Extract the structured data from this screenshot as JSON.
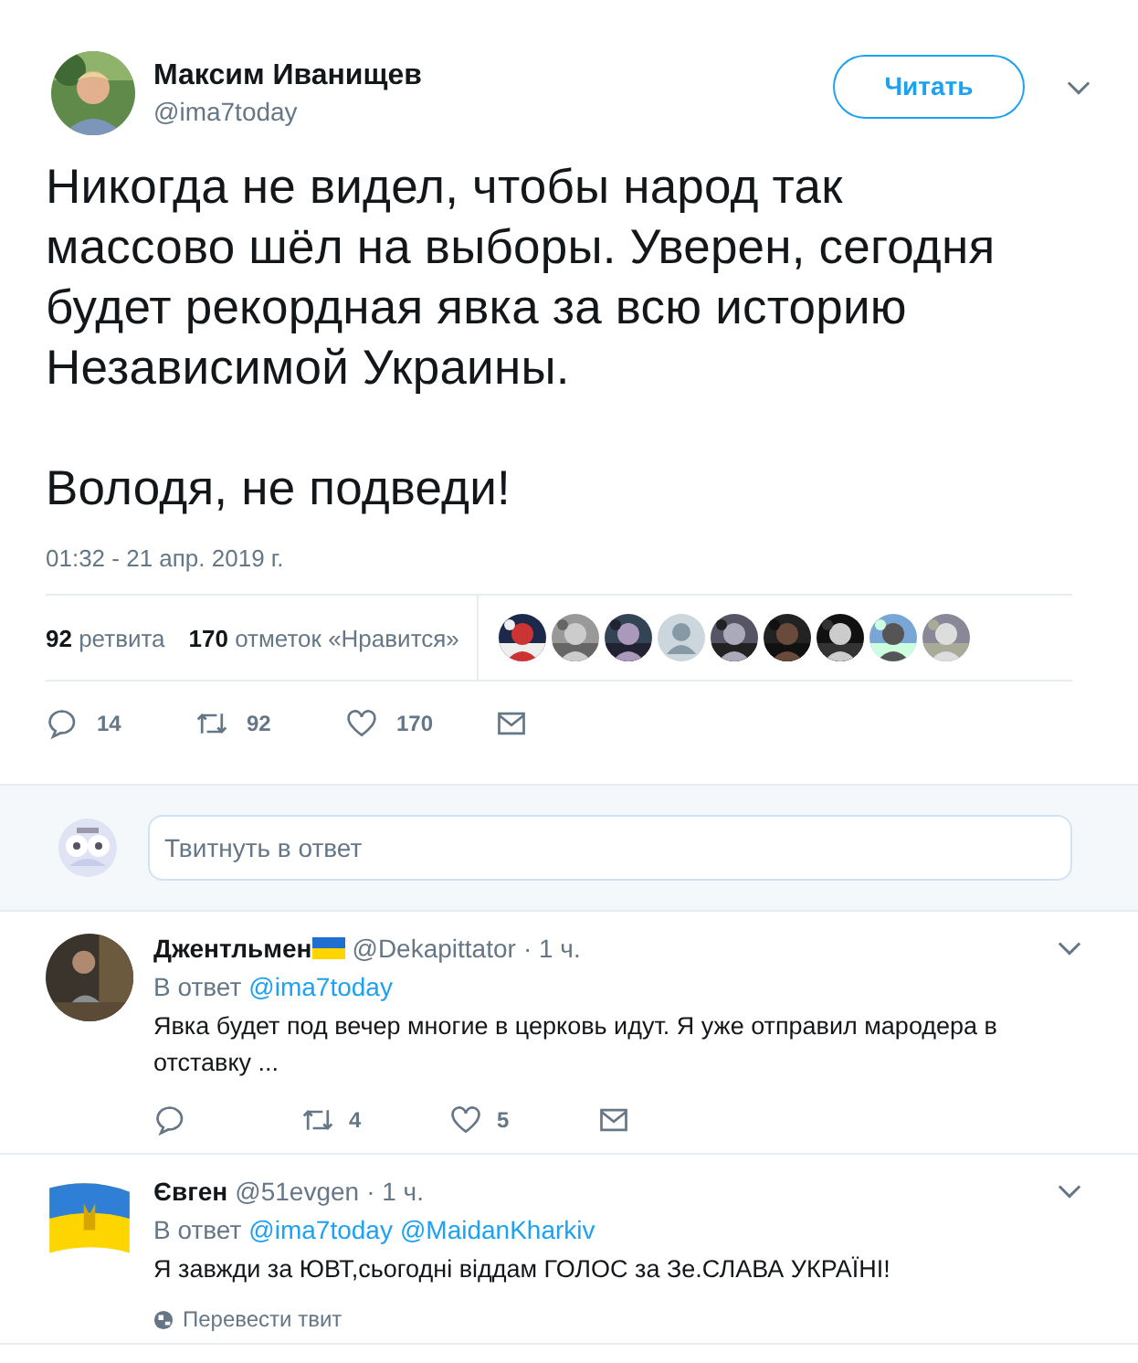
{
  "tweet": {
    "author": {
      "name": "Максим Иванищев",
      "handle": "@ima7today"
    },
    "follow_button": "Читать",
    "paragraphs": [
      "Никогда не видел, чтобы народ так массово шёл на выборы. Уверен, сегодня будет рекордная явка за всю историю Независимой Украины.",
      "Володя, не подведи!"
    ],
    "timestamp": "01:32 - 21 апр. 2019 г.",
    "stats": [
      {
        "count": "92",
        "label": "ретвита"
      },
      {
        "count": "170",
        "label": "отметок «Нравится»"
      }
    ],
    "likers": [
      {
        "kind": "picture"
      },
      {
        "kind": "picture"
      },
      {
        "kind": "picture"
      },
      {
        "kind": "default"
      },
      {
        "kind": "picture"
      },
      {
        "kind": "picture"
      },
      {
        "kind": "picture"
      },
      {
        "kind": "picture"
      },
      {
        "kind": "picture"
      }
    ],
    "actions": [
      {
        "kind": "reply",
        "count": "14"
      },
      {
        "kind": "retweet",
        "count": "92"
      },
      {
        "kind": "like",
        "count": "170"
      },
      {
        "kind": "message"
      }
    ]
  },
  "reply_box": {
    "placeholder": "Твитнуть в ответ"
  },
  "replies": [
    {
      "name": "Джентльмен",
      "flag": true,
      "handle": "@Dekapittator",
      "time": "· 1 ч.",
      "in_reply_label": "В ответ",
      "mentions": [
        "@ima7today"
      ],
      "text": "Явка будет под вечер многие в церковь идут. Я уже отправил мародера в отставку ...",
      "actions": [
        {
          "kind": "reply"
        },
        {
          "kind": "retweet",
          "count": "4"
        },
        {
          "kind": "like",
          "count": "5"
        },
        {
          "kind": "message"
        }
      ]
    },
    {
      "name": "Євген",
      "flag": false,
      "handle": "@51evgen",
      "time": "· 1 ч.",
      "in_reply_label": "В ответ",
      "mentions": [
        "@ima7today",
        "@MaidanKharkiv"
      ],
      "text": "Я завжди за ЮВТ,сьогодні віддам ГОЛОС за Зе.СЛАВА УКРАЇНІ!",
      "translate": "Перевести твит"
    }
  ]
}
